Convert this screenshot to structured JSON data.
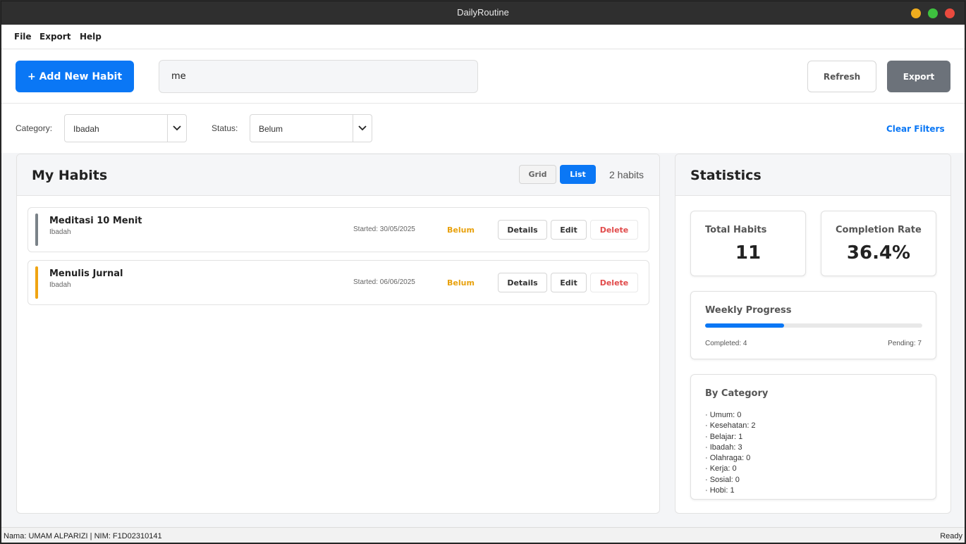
{
  "window": {
    "title": "DailyRoutine"
  },
  "menu": [
    "File",
    "Export",
    "Help"
  ],
  "toolbar": {
    "add_label": "+ Add New Habit",
    "search_value": "me",
    "refresh_label": "Refresh",
    "export_label": "Export"
  },
  "filters": {
    "category_label": "Category:",
    "category_value": "Ibadah",
    "status_label": "Status:",
    "status_value": "Belum",
    "clear_label": "Clear Filters"
  },
  "habits": {
    "title": "My Habits",
    "grid_label": "Grid",
    "list_label": "List",
    "count_text": "2 habits",
    "details_label": "Details",
    "edit_label": "Edit",
    "delete_label": "Delete",
    "items": [
      {
        "name": "Meditasi 10 Menit",
        "category": "Ibadah",
        "started": "Started: 30/05/2025",
        "status": "Belum",
        "color": "#7a8288"
      },
      {
        "name": "Menulis Jurnal",
        "category": "Ibadah",
        "started": "Started: 06/06/2025",
        "status": "Belum",
        "color": "#f0a412"
      }
    ]
  },
  "stats": {
    "title": "Statistics",
    "total_label": "Total Habits",
    "total_value": "11",
    "rate_label": "Completion Rate",
    "rate_value": "36.4%",
    "weekly_label": "Weekly Progress",
    "weekly_fraction": 0.364,
    "completed_text": "Completed: 4",
    "pending_text": "Pending: 7",
    "by_category_label": "By Category",
    "categories": [
      "· Umum: 0",
      "· Kesehatan: 2",
      "· Belajar: 1",
      "· Ibadah: 3",
      "· Olahraga: 0",
      "· Kerja: 0",
      "· Sosial: 0",
      "· Hobi: 1"
    ]
  },
  "statusbar": {
    "left": "Nama: UMAM ALPARIZI | NIM: F1D02310141",
    "right": "Ready"
  },
  "colors": {
    "accent": "#0a77f5",
    "warning": "#e8a10c",
    "danger": "#e14b4b"
  }
}
